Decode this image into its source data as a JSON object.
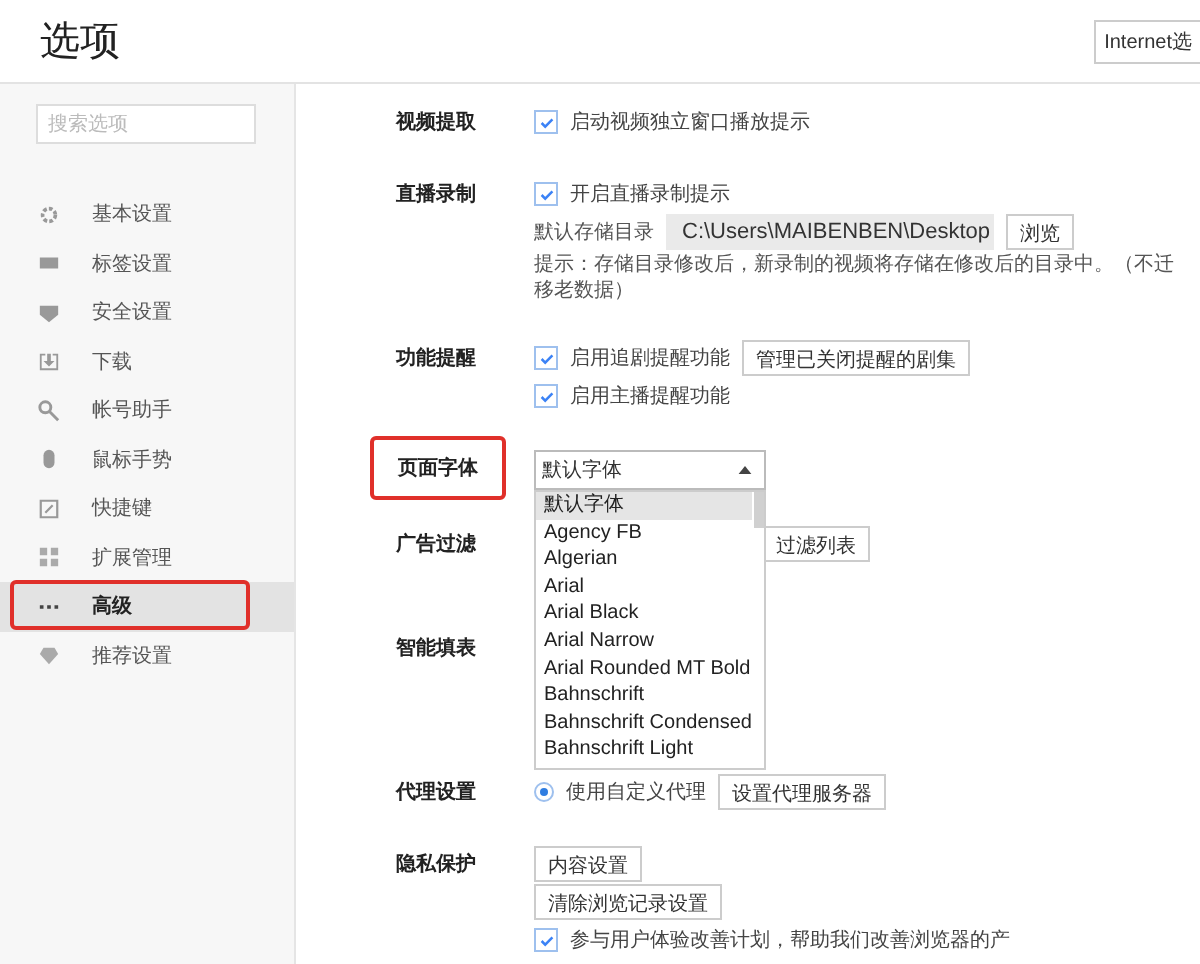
{
  "window": {
    "title": "选项",
    "internet_button": "Internet选"
  },
  "sidebar": {
    "search": {
      "placeholder": "搜索选项"
    },
    "items": [
      {
        "label": "基本设置",
        "selected": false,
        "highlighted": false
      },
      {
        "label": "标签设置",
        "selected": false,
        "highlighted": false
      },
      {
        "label": "安全设置",
        "selected": false,
        "highlighted": false
      },
      {
        "label": "下载",
        "selected": false,
        "highlighted": false
      },
      {
        "label": "帐号助手",
        "selected": false,
        "highlighted": false
      },
      {
        "label": "鼠标手势",
        "selected": false,
        "highlighted": false
      },
      {
        "label": "快捷键",
        "selected": false,
        "highlighted": false
      },
      {
        "label": "扩展管理",
        "selected": false,
        "highlighted": false
      },
      {
        "label": "高级",
        "selected": true,
        "highlighted": true
      },
      {
        "label": "推荐设置",
        "selected": false,
        "highlighted": false
      }
    ]
  },
  "sections": [
    {
      "label": "视频提取",
      "highlighted": false,
      "rows": [
        [
          {
            "kind": "checkbox",
            "label": "启动视频独立窗口播放提示",
            "checked": true
          }
        ]
      ]
    },
    {
      "label": "直播录制",
      "highlighted": false,
      "rows": [
        [
          {
            "kind": "checkbox",
            "label": "开启直播录制提示",
            "checked": true
          }
        ],
        [
          {
            "kind": "text",
            "text": "默认存储目录"
          },
          {
            "kind": "path",
            "value": "C:\\Users\\MAIBENBEN\\Desktop"
          },
          {
            "kind": "button",
            "label": "浏览"
          }
        ],
        [
          {
            "kind": "text",
            "text": "提示：存储目录修改后，新录制的视频将存储在修改后的目录中。（不迁移老数据）"
          }
        ]
      ]
    },
    {
      "label": "功能提醒",
      "highlighted": false,
      "rows": [
        [
          {
            "kind": "checkbox",
            "label": "启用追剧提醒功能",
            "checked": true
          },
          {
            "kind": "button",
            "label": "管理已关闭提醒的剧集"
          }
        ],
        [
          {
            "kind": "checkbox",
            "label": "启用主播提醒功能",
            "checked": true
          }
        ]
      ]
    },
    {
      "label": "页面字体",
      "highlighted": true,
      "rows": [
        [
          {
            "kind": "select",
            "value": "默认字体",
            "expanded": true,
            "options": [
              {
                "label": "默认字体",
                "selected": true
              },
              {
                "label": "Agency FB",
                "selected": false
              },
              {
                "label": "Algerian",
                "selected": false
              },
              {
                "label": "Arial",
                "selected": false
              },
              {
                "label": "Arial Black",
                "selected": false
              },
              {
                "label": "Arial Narrow",
                "selected": false
              },
              {
                "label": "Arial Rounded MT Bold",
                "selected": false
              },
              {
                "label": "Bahnschrift",
                "selected": false
              },
              {
                "label": "Bahnschrift Condensed",
                "selected": false
              },
              {
                "label": "Bahnschrift Light",
                "selected": false
              }
            ]
          }
        ]
      ]
    },
    {
      "label": "广告过滤",
      "highlighted": false,
      "rows": [
        [
          {
            "kind": "spacer"
          },
          {
            "kind": "button",
            "label": "过滤列表"
          }
        ]
      ]
    },
    {
      "label": "智能填表",
      "highlighted": false
    },
    {
      "label": "代理设置",
      "highlighted": false,
      "rows": [
        [
          {
            "kind": "radio",
            "label": "使用自定义代理",
            "selected": true
          },
          {
            "kind": "button",
            "label": "设置代理服务器"
          }
        ]
      ]
    },
    {
      "label": "隐私保护",
      "highlighted": false,
      "rows": [
        [
          {
            "kind": "button",
            "label": "内容设置"
          }
        ],
        [
          {
            "kind": "button",
            "label": "清除浏览记录设置"
          }
        ],
        [
          {
            "kind": "checkbox",
            "label": "参与用户体验改善计划，帮助我们改善浏览器的产",
            "checked": true
          }
        ]
      ]
    }
  ]
}
